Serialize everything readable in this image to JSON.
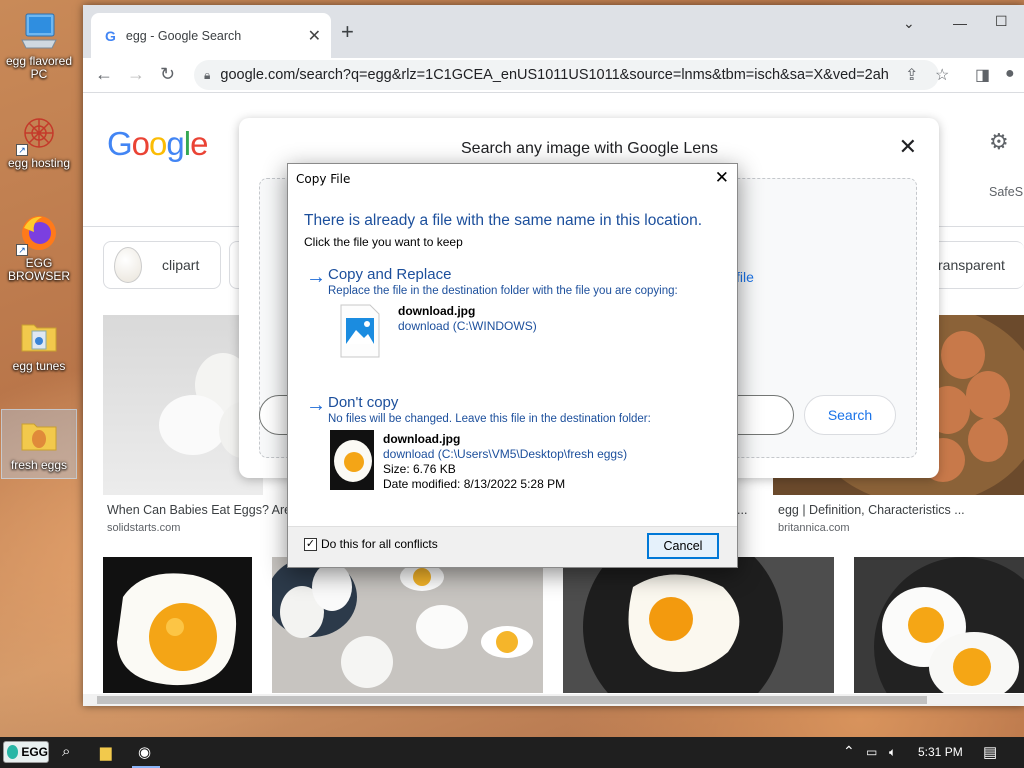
{
  "desktop": {
    "icons": [
      {
        "label": "egg flavored PC"
      },
      {
        "label": "egg hosting"
      },
      {
        "label": "EGG BROWSER"
      },
      {
        "label": "egg tunes"
      },
      {
        "label": "fresh eggs"
      }
    ]
  },
  "browser": {
    "tab_title": "egg - Google Search",
    "url": "google.com/search?q=egg&rlz=1C1GCEA_enUS1011US1011&source=lnms&tbm=isch&sa=X&ved=2ahU..."
  },
  "google": {
    "logo": [
      "G",
      "o",
      "o",
      "g",
      "l",
      "e"
    ],
    "logo_colors": [
      "#4285f4",
      "#ea4335",
      "#fbbc05",
      "#4285f4",
      "#34a853",
      "#ea4335"
    ],
    "safesearch": "SafeS",
    "chips": [
      {
        "label": "clipart"
      },
      {
        "label": "ransparent"
      }
    ],
    "lens": {
      "title": "Search any image with Google Lens",
      "upload_fragment": "file",
      "search_button": "Search"
    },
    "results": [
      {
        "caption": "When Can Babies Eat Eggs? Are",
        "source": "solidstarts.com"
      },
      {
        "caption": "...",
        "source": ""
      },
      {
        "caption": "egg | Definition, Characteristics ...",
        "source": "britannica.com"
      }
    ]
  },
  "dialog": {
    "title": "Copy File",
    "heading": "There is already a file with the same name in this location.",
    "subheading": "Click the file you want to keep",
    "option1": {
      "title": "Copy and Replace",
      "desc": "Replace the file in the destination folder with the file you are copying:",
      "file_name": "download.jpg",
      "file_path": "download (C:\\WINDOWS)"
    },
    "option2": {
      "title": "Don't copy",
      "desc": "No files will be changed. Leave this file in the destination folder:",
      "file_name": "download.jpg",
      "file_path": "download (C:\\Users\\VM5\\Desktop\\fresh eggs)",
      "size": "Size: 6.76 KB",
      "modified": "Date modified: 8/13/2022 5:28 PM"
    },
    "checkbox_label": "Do this for all conflicts",
    "checkbox_checked": true,
    "cancel": "Cancel"
  },
  "taskbar": {
    "start_label": "EGG",
    "time": "5:31 PM"
  }
}
